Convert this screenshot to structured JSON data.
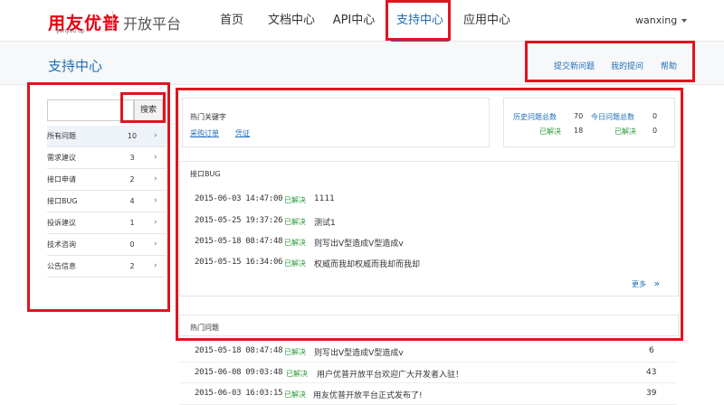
{
  "header": {
    "logo": "用友优普",
    "logo_sub": "yonyou up",
    "platform": "开放平台",
    "nav": [
      "首页",
      "文档中心",
      "API中心",
      "支持中心",
      "应用中心"
    ],
    "active_nav": "支持中心",
    "user": "wanxing"
  },
  "subheader": {
    "title": "支持中心",
    "links": [
      "提交新问题",
      "我的提问",
      "帮助"
    ]
  },
  "sidebar": {
    "search_placeholder": "",
    "search_button": "搜索",
    "items": [
      {
        "label": "所有问题",
        "count": "10",
        "chev": "›"
      },
      {
        "label": "需求建议",
        "count": "3",
        "chev": "›"
      },
      {
        "label": "接口申请",
        "count": "2",
        "chev": "›"
      },
      {
        "label": "接口BUG",
        "count": "4",
        "chev": "›"
      },
      {
        "label": "投诉建议",
        "count": "1",
        "chev": "›"
      },
      {
        "label": "技术咨询",
        "count": "0",
        "chev": "›"
      },
      {
        "label": "公告信息",
        "count": "2",
        "chev": "›"
      }
    ]
  },
  "keywords": {
    "title": "热门关键字",
    "links": [
      "采购订单",
      "凭证"
    ]
  },
  "stats": {
    "history_label": "历史问题总数",
    "history_value": "70",
    "history_resolved_label": "已解决",
    "history_resolved_value": "18",
    "today_label": "今日问题总数",
    "today_value": "0",
    "today_resolved_label": "已解决",
    "today_resolved_value": "0"
  },
  "bug_section": {
    "title": "接口BUG",
    "rows": [
      {
        "date": "2015-06-03 14:47:00",
        "status": "已解决",
        "text": "1111"
      },
      {
        "date": "2015-05-25 19:37:26",
        "status": "已解决",
        "text": "测试1"
      },
      {
        "date": "2015-05-18 08:47:48",
        "status": "已解决",
        "text": "则写出V型造成V型造成v"
      },
      {
        "date": "2015-05-15 16:34:06",
        "status": "已解决",
        "text": "权威而我却权威而我却而我却"
      }
    ],
    "more": "更多"
  },
  "hot_section": {
    "title": "热门问题",
    "rows": [
      {
        "date": "2015-05-18 08:47:48",
        "status": "已解决",
        "text": "则写出V型造成V型造成v",
        "count": "6"
      },
      {
        "date": "2015-06-08 09:03:48",
        "status": "已解决",
        "text": "用户优普开放平台欢迎广大开发者入驻！",
        "count": "43"
      },
      {
        "date": "2015-06-03 16:03:15",
        "status": "已解决",
        "text": "用友优普开放平台正式发布了!",
        "count": "39"
      }
    ]
  },
  "colors": {
    "accent": "#1e6db8",
    "highlight": "#e0141e",
    "resolved": "#2e9c3c",
    "logo": "#e60012"
  }
}
